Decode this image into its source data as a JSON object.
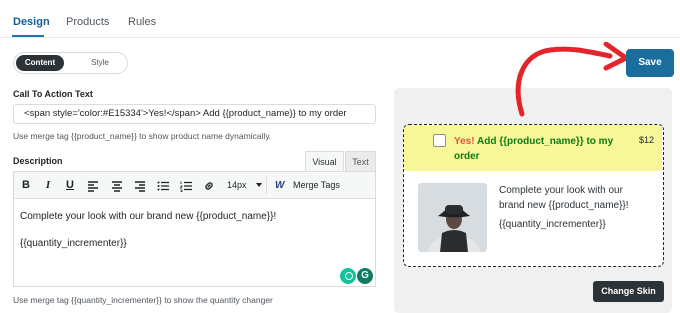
{
  "tabs": [
    {
      "label": "Design",
      "active": true
    },
    {
      "label": "Products",
      "active": false
    },
    {
      "label": "Rules",
      "active": false
    }
  ],
  "segmented": {
    "content": "Content",
    "style": "Style",
    "selected": "Content"
  },
  "cta": {
    "label": "Call To Action Text",
    "value": "<span style='color:#E15334'>Yes!</span> Add {{product_name}} to my order",
    "hint": "Use merge tag {{product_name}} to show product name dynamically."
  },
  "description": {
    "label": "Description",
    "mode_visual": "Visual",
    "mode_text": "Text",
    "font_size": "14px",
    "merge_tags_label": "Merge Tags",
    "toolbar_icons": [
      "bold-icon",
      "italic-icon",
      "underline-icon",
      "align-left-icon",
      "align-center-icon",
      "align-right-icon",
      "bulleted-list-icon",
      "numbered-list-icon",
      "link-icon"
    ],
    "body_line1": "Complete your look with our brand new {{product_name}}!",
    "body_line2": "{{quantity_incrementer}}",
    "hint": "Use merge tag {{quantity_incrementer}} to show the quantity changer"
  },
  "preview": {
    "yes": "Yes!",
    "headline": "Add {{product_name}} to my order",
    "price": "$12",
    "desc_line1": "Complete your look with our brand new {{product_name}}!",
    "desc_line2": "{{quantity_incrementer}}",
    "highlight_color": "#f7f79a",
    "yes_color": "#E15334",
    "headline_color": "#0d7a0d"
  },
  "buttons": {
    "save": "Save",
    "change_skin": "Change Skin"
  },
  "colors": {
    "accent": "#1a6e9e",
    "arrow": "#e3242b"
  }
}
